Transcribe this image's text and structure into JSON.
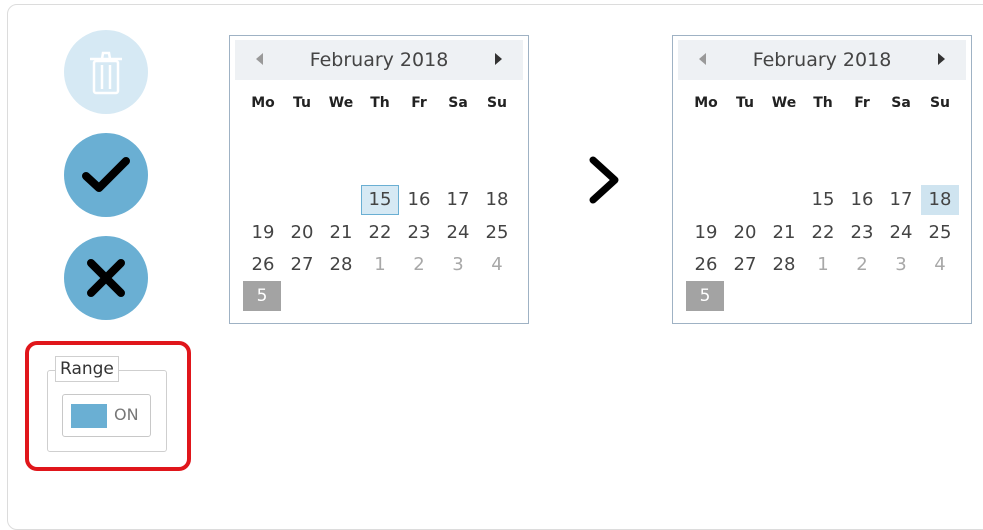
{
  "range": {
    "legend": "Range",
    "toggle_label": "ON"
  },
  "calendars": [
    {
      "title": "February 2018",
      "weekdays": [
        "Mo",
        "Tu",
        "We",
        "Th",
        "Fr",
        "Sa",
        "Su"
      ],
      "week_number": "5",
      "days": [
        "15",
        "16",
        "17",
        "18",
        "19",
        "20",
        "21",
        "22",
        "23",
        "24",
        "25",
        "26",
        "27",
        "28",
        "1",
        "2",
        "3",
        "4"
      ]
    },
    {
      "title": "February 2018",
      "weekdays": [
        "Mo",
        "Tu",
        "We",
        "Th",
        "Fr",
        "Sa",
        "Su"
      ],
      "week_number": "5",
      "days": [
        "15",
        "16",
        "17",
        "18",
        "19",
        "20",
        "21",
        "22",
        "23",
        "24",
        "25",
        "26",
        "27",
        "28",
        "1",
        "2",
        "3",
        "4"
      ]
    }
  ],
  "icons": {
    "delete": "trash-icon",
    "ok": "checkmark-icon",
    "cancel": "close-icon",
    "range_arrow": "chevron-right-icon"
  },
  "colors": {
    "accent": "#6aafd3",
    "accent_light": "#d6e9f4",
    "highlight_border": "#e0161b"
  }
}
